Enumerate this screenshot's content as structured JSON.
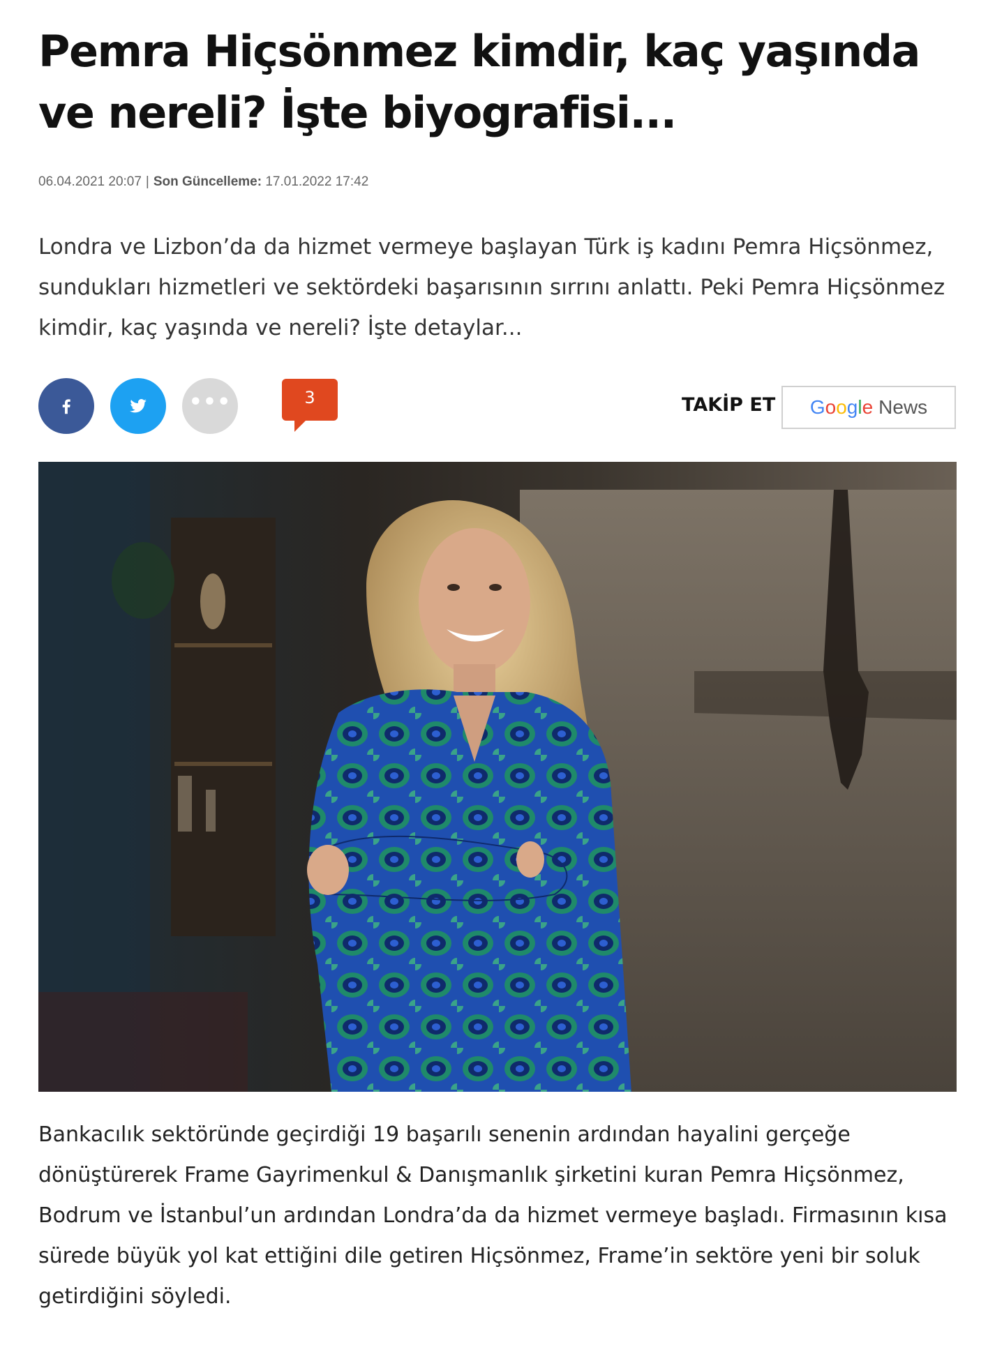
{
  "article": {
    "title": "Pemra Hiçsönmez kimdir, kaç yaşında ve nereli? İşte biyografisi...",
    "published": "06.04.2021 20:07",
    "separator": "|",
    "updated_label": "Son Güncelleme:",
    "updated": "17.01.2022 17:42",
    "spot": "Londra ve Lizbon’da da hizmet vermeye başlayan Türk iş kadını Pemra Hiçsönmez, sundukları hizmetleri ve sektördeki başarısının sırrını anlattı. Peki Pemra Hiçsönmez kimdir, kaç yaşında ve nereli? İşte detaylar...",
    "body": "Bankacılık sektöründe geçirdiği 19 başarılı senenin ardından hayalini gerçeğe dönüştürerek Frame Gayrimenkul & Danışmanlık şirketini kuran Pemra Hiçsönmez, Bodrum ve İstanbul’un ardından Londra’da da hizmet vermeye başladı. Firmasının kısa sürede büyük yol kat ettiğini dile getiren Hiçsönmez, Frame’in sektöre yeni bir soluk getirdiğini söyledi."
  },
  "share": {
    "facebook_icon": "facebook-icon",
    "twitter_icon": "twitter-icon",
    "more_icon": "more-icon",
    "more_glyph": "•••",
    "comment_count": "3"
  },
  "follow": {
    "label": "TAKİP ET",
    "google_letters": [
      "G",
      "o",
      "o",
      "g",
      "l",
      "e"
    ],
    "news_label": "News"
  },
  "colors": {
    "facebook": "#3b5998",
    "twitter": "#1da1f2",
    "comment": "#e0481f",
    "more": "#d9d9d9"
  }
}
